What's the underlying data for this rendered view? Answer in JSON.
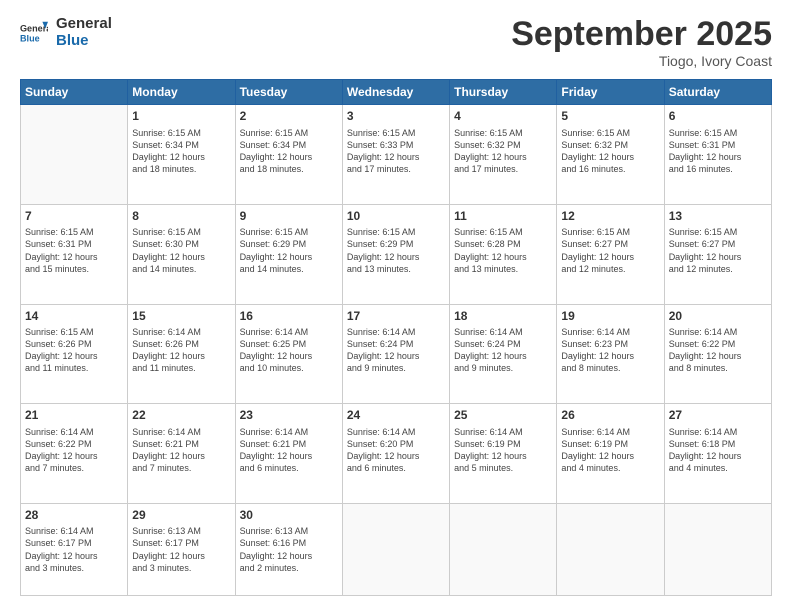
{
  "header": {
    "logo_general": "General",
    "logo_blue": "Blue",
    "month_title": "September 2025",
    "location": "Tiogo, Ivory Coast"
  },
  "weekdays": [
    "Sunday",
    "Monday",
    "Tuesday",
    "Wednesday",
    "Thursday",
    "Friday",
    "Saturday"
  ],
  "weeks": [
    [
      {
        "day": "",
        "info": ""
      },
      {
        "day": "1",
        "info": "Sunrise: 6:15 AM\nSunset: 6:34 PM\nDaylight: 12 hours\nand 18 minutes."
      },
      {
        "day": "2",
        "info": "Sunrise: 6:15 AM\nSunset: 6:34 PM\nDaylight: 12 hours\nand 18 minutes."
      },
      {
        "day": "3",
        "info": "Sunrise: 6:15 AM\nSunset: 6:33 PM\nDaylight: 12 hours\nand 17 minutes."
      },
      {
        "day": "4",
        "info": "Sunrise: 6:15 AM\nSunset: 6:32 PM\nDaylight: 12 hours\nand 17 minutes."
      },
      {
        "day": "5",
        "info": "Sunrise: 6:15 AM\nSunset: 6:32 PM\nDaylight: 12 hours\nand 16 minutes."
      },
      {
        "day": "6",
        "info": "Sunrise: 6:15 AM\nSunset: 6:31 PM\nDaylight: 12 hours\nand 16 minutes."
      }
    ],
    [
      {
        "day": "7",
        "info": "Sunrise: 6:15 AM\nSunset: 6:31 PM\nDaylight: 12 hours\nand 15 minutes."
      },
      {
        "day": "8",
        "info": "Sunrise: 6:15 AM\nSunset: 6:30 PM\nDaylight: 12 hours\nand 14 minutes."
      },
      {
        "day": "9",
        "info": "Sunrise: 6:15 AM\nSunset: 6:29 PM\nDaylight: 12 hours\nand 14 minutes."
      },
      {
        "day": "10",
        "info": "Sunrise: 6:15 AM\nSunset: 6:29 PM\nDaylight: 12 hours\nand 13 minutes."
      },
      {
        "day": "11",
        "info": "Sunrise: 6:15 AM\nSunset: 6:28 PM\nDaylight: 12 hours\nand 13 minutes."
      },
      {
        "day": "12",
        "info": "Sunrise: 6:15 AM\nSunset: 6:27 PM\nDaylight: 12 hours\nand 12 minutes."
      },
      {
        "day": "13",
        "info": "Sunrise: 6:15 AM\nSunset: 6:27 PM\nDaylight: 12 hours\nand 12 minutes."
      }
    ],
    [
      {
        "day": "14",
        "info": "Sunrise: 6:15 AM\nSunset: 6:26 PM\nDaylight: 12 hours\nand 11 minutes."
      },
      {
        "day": "15",
        "info": "Sunrise: 6:14 AM\nSunset: 6:26 PM\nDaylight: 12 hours\nand 11 minutes."
      },
      {
        "day": "16",
        "info": "Sunrise: 6:14 AM\nSunset: 6:25 PM\nDaylight: 12 hours\nand 10 minutes."
      },
      {
        "day": "17",
        "info": "Sunrise: 6:14 AM\nSunset: 6:24 PM\nDaylight: 12 hours\nand 9 minutes."
      },
      {
        "day": "18",
        "info": "Sunrise: 6:14 AM\nSunset: 6:24 PM\nDaylight: 12 hours\nand 9 minutes."
      },
      {
        "day": "19",
        "info": "Sunrise: 6:14 AM\nSunset: 6:23 PM\nDaylight: 12 hours\nand 8 minutes."
      },
      {
        "day": "20",
        "info": "Sunrise: 6:14 AM\nSunset: 6:22 PM\nDaylight: 12 hours\nand 8 minutes."
      }
    ],
    [
      {
        "day": "21",
        "info": "Sunrise: 6:14 AM\nSunset: 6:22 PM\nDaylight: 12 hours\nand 7 minutes."
      },
      {
        "day": "22",
        "info": "Sunrise: 6:14 AM\nSunset: 6:21 PM\nDaylight: 12 hours\nand 7 minutes."
      },
      {
        "day": "23",
        "info": "Sunrise: 6:14 AM\nSunset: 6:21 PM\nDaylight: 12 hours\nand 6 minutes."
      },
      {
        "day": "24",
        "info": "Sunrise: 6:14 AM\nSunset: 6:20 PM\nDaylight: 12 hours\nand 6 minutes."
      },
      {
        "day": "25",
        "info": "Sunrise: 6:14 AM\nSunset: 6:19 PM\nDaylight: 12 hours\nand 5 minutes."
      },
      {
        "day": "26",
        "info": "Sunrise: 6:14 AM\nSunset: 6:19 PM\nDaylight: 12 hours\nand 4 minutes."
      },
      {
        "day": "27",
        "info": "Sunrise: 6:14 AM\nSunset: 6:18 PM\nDaylight: 12 hours\nand 4 minutes."
      }
    ],
    [
      {
        "day": "28",
        "info": "Sunrise: 6:14 AM\nSunset: 6:17 PM\nDaylight: 12 hours\nand 3 minutes."
      },
      {
        "day": "29",
        "info": "Sunrise: 6:13 AM\nSunset: 6:17 PM\nDaylight: 12 hours\nand 3 minutes."
      },
      {
        "day": "30",
        "info": "Sunrise: 6:13 AM\nSunset: 6:16 PM\nDaylight: 12 hours\nand 2 minutes."
      },
      {
        "day": "",
        "info": ""
      },
      {
        "day": "",
        "info": ""
      },
      {
        "day": "",
        "info": ""
      },
      {
        "day": "",
        "info": ""
      }
    ]
  ]
}
